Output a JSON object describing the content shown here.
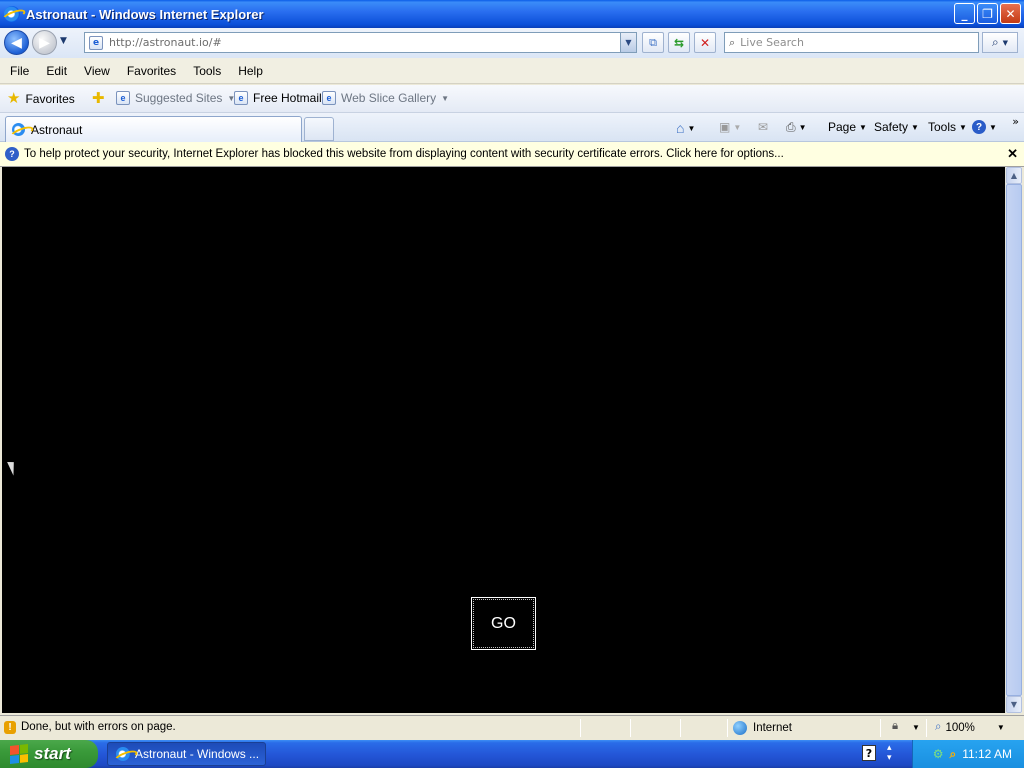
{
  "window": {
    "title": "Astronaut - Windows Internet Explorer",
    "minimize": "_",
    "maximize": "❐",
    "close": "✕"
  },
  "address": {
    "url": "http://astronaut.io/#",
    "search_placeholder": "Live Search"
  },
  "menu": [
    "File",
    "Edit",
    "View",
    "Favorites",
    "Tools",
    "Help"
  ],
  "favorites": {
    "label": "Favorites",
    "items": [
      "Suggested Sites",
      "Free Hotmail",
      "Web Slice Gallery"
    ]
  },
  "tab": {
    "title": "Astronaut"
  },
  "commands": {
    "page": "Page",
    "safety": "Safety",
    "tools": "Tools"
  },
  "infobar": {
    "message": "To help protect your security, Internet Explorer has blocked this website from displaying content with security certificate errors. Click here for options..."
  },
  "content": {
    "background": "#000000",
    "go_label": "GO"
  },
  "status": {
    "text": "Done, but with errors on page.",
    "zone": "Internet",
    "zoom": "100%"
  },
  "taskbar": {
    "start_label": "start",
    "task_item": "Astronaut - Windows ...",
    "clock": "11:12 AM"
  },
  "colors": {
    "titlebar_blue": "#0a5ce8",
    "infobar_bg": "#ffffe1",
    "start_green": "#3a9a3a"
  }
}
